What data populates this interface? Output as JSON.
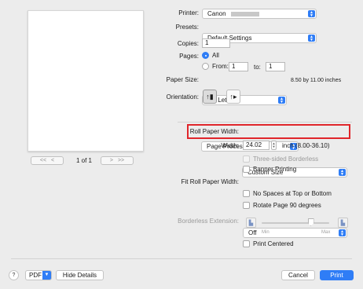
{
  "pager": {
    "first": "<<",
    "prev": "<",
    "page_text": "1 of 1",
    "next": ">",
    "last": ">>"
  },
  "printer": {
    "label": "Printer:",
    "value": "Canon"
  },
  "presets": {
    "label": "Presets:",
    "value": "Default Settings"
  },
  "copies": {
    "label": "Copies:",
    "value": "1"
  },
  "pages": {
    "label": "Pages:",
    "all_label": "All",
    "from_label": "From:",
    "from_value": "1",
    "to_label": "to:",
    "to_value": "1",
    "selected": "All"
  },
  "paper_size": {
    "label": "Paper Size:",
    "value": "US Letter",
    "dimensions": "8.50 by 11.00 inches"
  },
  "orientation": {
    "label": "Orientation:",
    "selected": "portrait"
  },
  "section_menu": {
    "value": "Page Processing"
  },
  "roll_paper_width": {
    "label": "Roll Paper Width:",
    "value": "Custom Size"
  },
  "width": {
    "label": "Width:",
    "value": "24.02",
    "unit_range": "inch (8.00-36.10)"
  },
  "options": {
    "three_sided_borderless": "Three-sided Borderless",
    "banner_printing": "Banner Printing"
  },
  "fit_roll": {
    "label": "Fit Roll Paper Width:",
    "value": "Off"
  },
  "options2": {
    "no_spaces": "No Spaces at Top or Bottom",
    "rotate": "Rotate Page 90 degrees"
  },
  "borderless_extension": {
    "label": "Borderless Extension:",
    "min_label": "Min",
    "max_label": "Max",
    "level": 0.75
  },
  "print_centered": {
    "label": "Print Centered"
  },
  "footer": {
    "help": "?",
    "pdf": "PDF",
    "hide_details": "Hide Details",
    "cancel": "Cancel",
    "print": "Print"
  },
  "colors": {
    "accent": "#2f7df6",
    "highlight": "#e0262b"
  }
}
